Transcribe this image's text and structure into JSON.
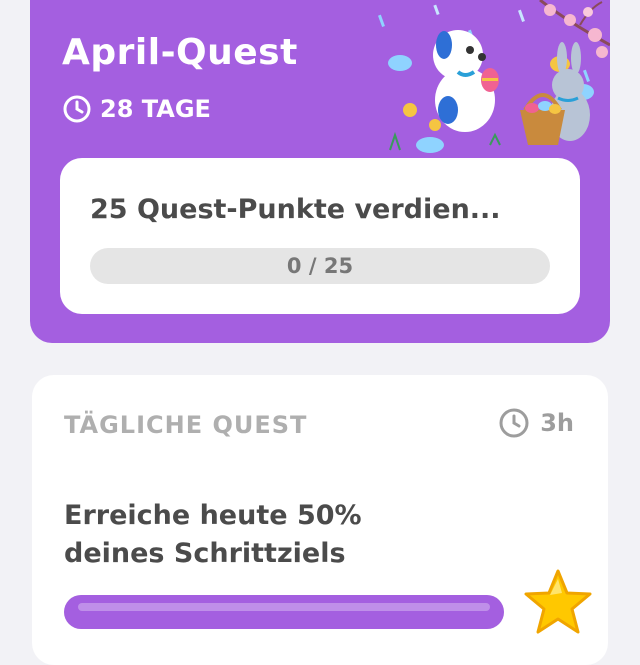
{
  "monthly": {
    "title": "April-Quest",
    "days_left": "28 TAGE",
    "task": "25 Quest-Punkte verdien...",
    "progress_text": "0 / 25",
    "progress_fraction": 0
  },
  "daily": {
    "header": "TÄGLICHE QUEST",
    "timer": "3h",
    "task": "Erreiche heute 50% deines Schrittziels",
    "progress_fraction": 1
  },
  "icons": {
    "clock": "clock-icon",
    "reward": "star-icon",
    "artwork": "easter-illustration"
  },
  "colors": {
    "accent": "#a45fe0",
    "track": "#e5e5e5",
    "star": "#ffc800"
  }
}
